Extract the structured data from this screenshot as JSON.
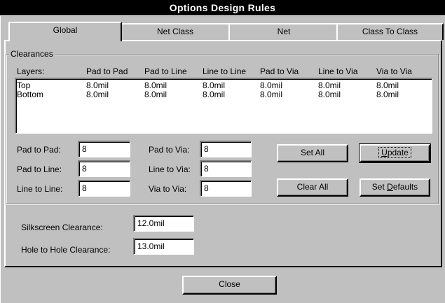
{
  "window": {
    "title": "Options Design Rules"
  },
  "tabs": [
    "Global",
    "Net Class",
    "Net",
    "Class To Class"
  ],
  "clearances": {
    "group_title": "Clearances",
    "columns": [
      "Layers:",
      "Pad to Pad",
      "Pad to Line",
      "Line to Line",
      "Pad to Via",
      "Line to Via",
      "Via to Via"
    ],
    "rows": [
      [
        "Top",
        "8.0mil",
        "8.0mil",
        "8.0mil",
        "8.0mil",
        "8.0mil",
        "8.0mil"
      ],
      [
        "Bottom",
        "8.0mil",
        "8.0mil",
        "8.0mil",
        "8.0mil",
        "8.0mil",
        "8.0mil"
      ]
    ],
    "fields": {
      "pad_to_pad": {
        "label": "Pad to Pad:",
        "value": "8"
      },
      "pad_to_line": {
        "label": "Pad to Line:",
        "value": "8"
      },
      "line_to_line": {
        "label": "Line to Line:",
        "value": "8"
      },
      "pad_to_via": {
        "label": "Pad to Via:",
        "value": "8"
      },
      "line_to_via": {
        "label": "Line to Via:",
        "value": "8"
      },
      "via_to_via": {
        "label": "Via to Via:",
        "value": "8"
      }
    },
    "buttons": {
      "set_all": "Set All",
      "clear_all": "Clear All",
      "update_mnemonic": "U",
      "update_rest": "pdate",
      "set_defaults_pre": "Set ",
      "set_defaults_mnemonic": "D",
      "set_defaults_rest": "efaults"
    }
  },
  "silkscreen": {
    "label": "Silkscreen Clearance:",
    "value": "12.0mil"
  },
  "hole_to_hole": {
    "label": "Hole to Hole Clearance:",
    "value": "13.0mil"
  },
  "footer": {
    "close_label": "Close"
  }
}
